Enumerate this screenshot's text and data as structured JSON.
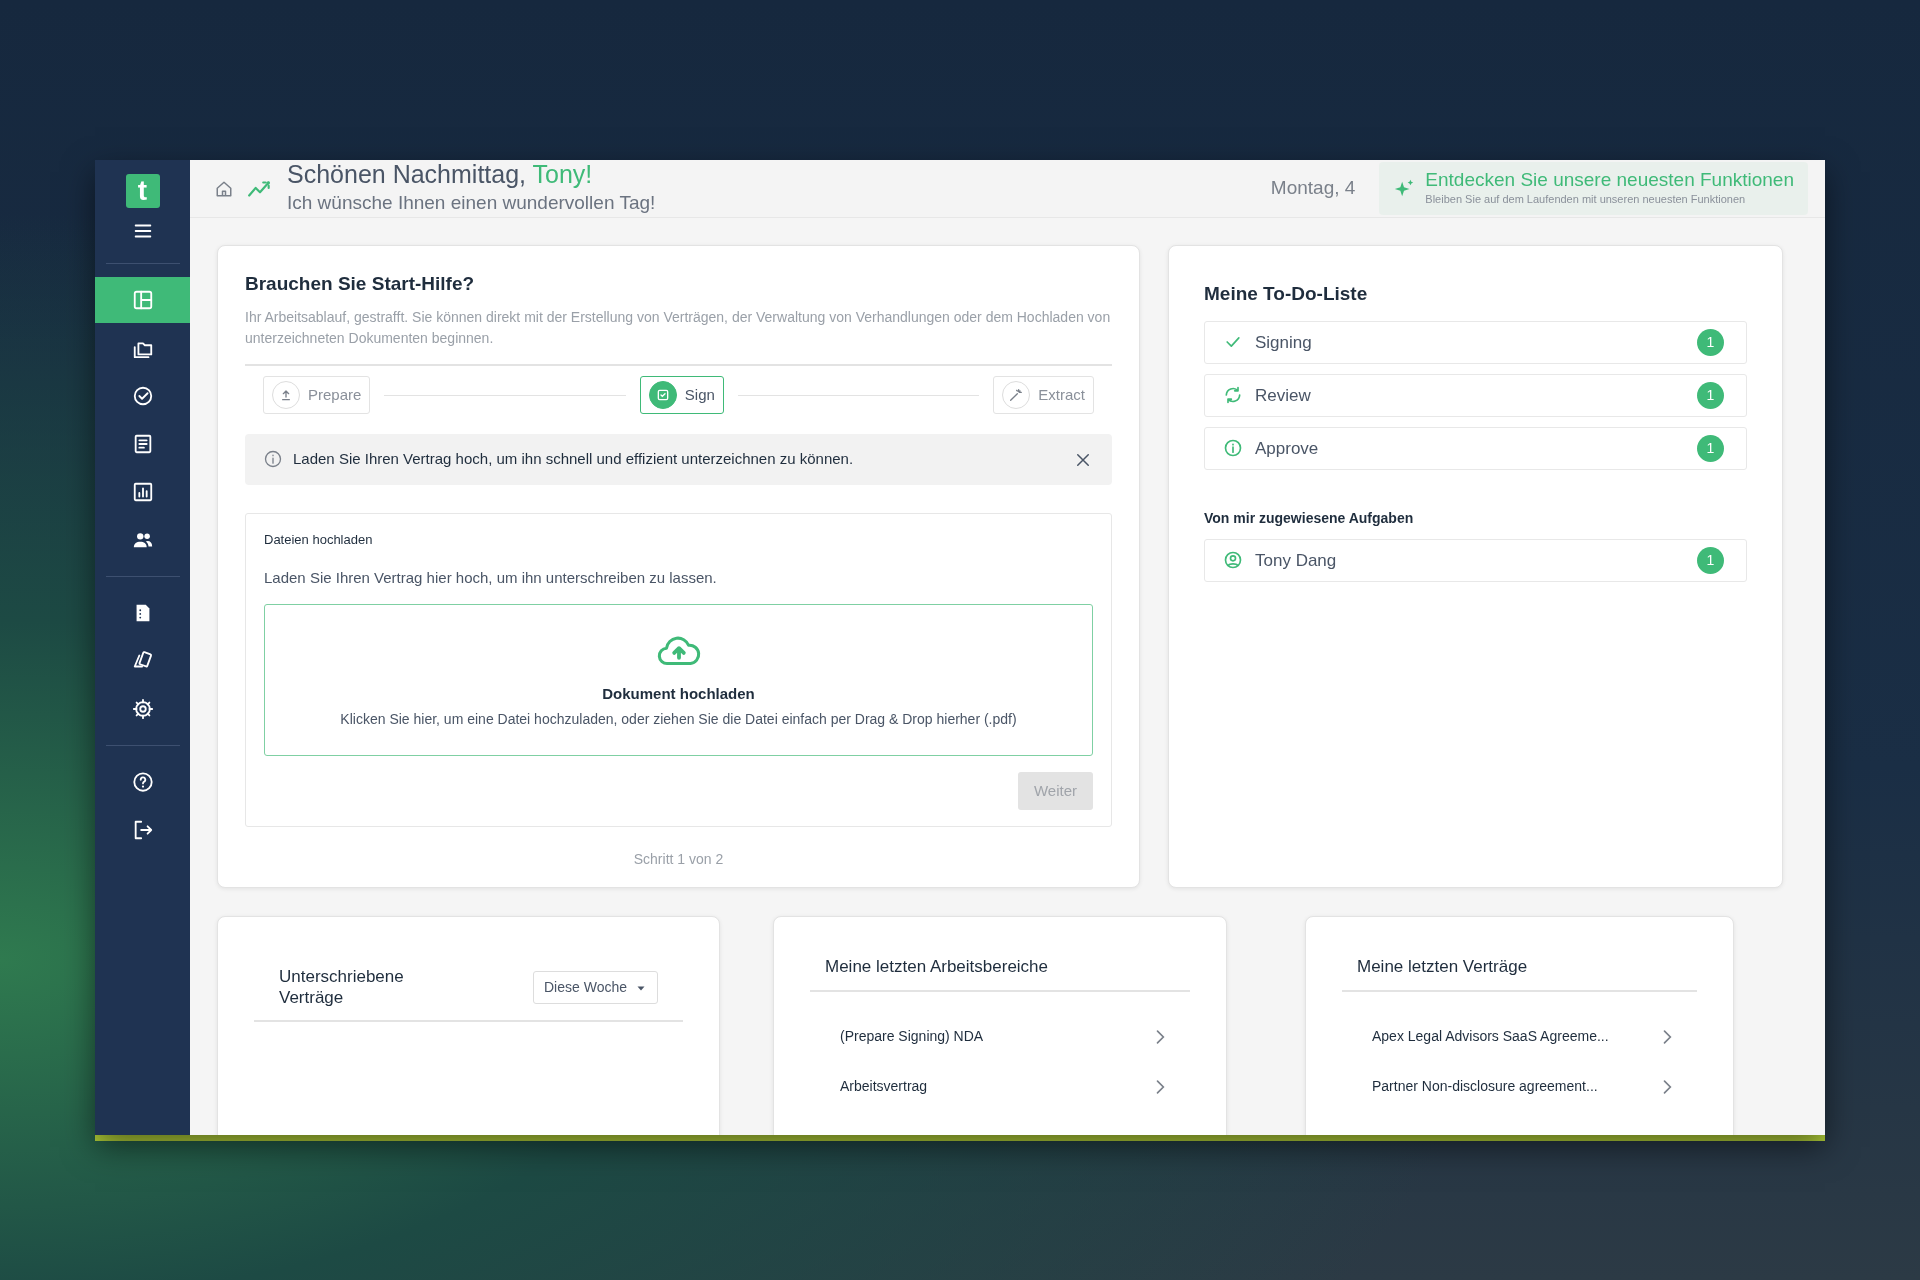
{
  "sidebar": {
    "logo": "t",
    "groups": [
      [
        {
          "kind": "layout",
          "selected": true
        },
        {
          "kind": "folders",
          "selected": false
        },
        {
          "kind": "check",
          "selected": false
        },
        {
          "kind": "document",
          "selected": false
        },
        {
          "kind": "chart",
          "selected": false
        },
        {
          "kind": "people",
          "selected": false
        }
      ],
      [
        {
          "kind": "file",
          "selected": false
        },
        {
          "kind": "cards",
          "selected": false
        },
        {
          "kind": "settings",
          "selected": false
        }
      ],
      [
        {
          "kind": "help",
          "selected": false
        },
        {
          "kind": "logout",
          "selected": false
        }
      ]
    ]
  },
  "header": {
    "greeting": "Schönen Nachmittag,",
    "name": "Tony!",
    "subtitle": "Ich wünsche Ihnen einen wundervollen Tag!",
    "date": "Montag, 4",
    "promo_title": "Entdecken Sie unsere neuesten Funktionen",
    "promo_subtitle": "Bleiben Sie auf dem Laufenden mit unseren neuesten Funktionen"
  },
  "start_card": {
    "title": "Brauchen Sie Start-Hilfe?",
    "description": "Ihr Arbeitsablauf, gestrafft. Sie können direkt mit der Erstellung von Verträgen, der Verwaltung von Verhandlungen oder dem Hochladen von unterzeichneten Dokumenten beginnen.",
    "steps": [
      {
        "kind": "upload",
        "label": "Prepare",
        "selected": false
      },
      {
        "kind": "sign",
        "label": "Sign",
        "selected": true
      },
      {
        "kind": "wand",
        "label": "Extract",
        "selected": false
      }
    ],
    "alert": "Laden Sie Ihren Vertrag hoch, um ihn schnell und effizient unterzeichnen zu können.",
    "upload": {
      "label": "Dateien hochladen",
      "hint": "Laden Sie Ihren Vertrag hier hoch, um ihn unterschreiben zu lassen.",
      "drop_title": "Dokument hochladen",
      "drop_text": "Klicken Sie hier, um eine Datei hochzuladen, oder ziehen Sie die Datei einfach per Drag & Drop hierher (.pdf)",
      "button": {
        "label": "Weiter",
        "disabled": true
      }
    },
    "footer": "Schritt 1 von 2"
  },
  "todo": {
    "title": "Meine To-Do-Liste",
    "items": [
      {
        "kind": "check",
        "label": "Signing",
        "count": "1"
      },
      {
        "kind": "sync",
        "label": "Review",
        "count": "1"
      },
      {
        "kind": "info",
        "label": "Approve",
        "count": "1"
      }
    ],
    "assigned_title": "Von mir zugewiesene Aufgaben",
    "assigned": [
      {
        "kind": "user",
        "label": "Tony Dang",
        "count": "1"
      }
    ]
  },
  "signed_card": {
    "title": "Unterschriebene Verträge",
    "dropdown": "Diese Woche"
  },
  "workspaces_card": {
    "title": "Meine letzten Arbeitsbereiche",
    "items": [
      "(Prepare Signing) NDA",
      "Arbeitsvertrag"
    ]
  },
  "contracts_card": {
    "title": "Meine letzten Verträge",
    "items": [
      "Apex Legal Advisors SaaS Agreeme...",
      "Partner Non-disclosure agreement..."
    ]
  }
}
